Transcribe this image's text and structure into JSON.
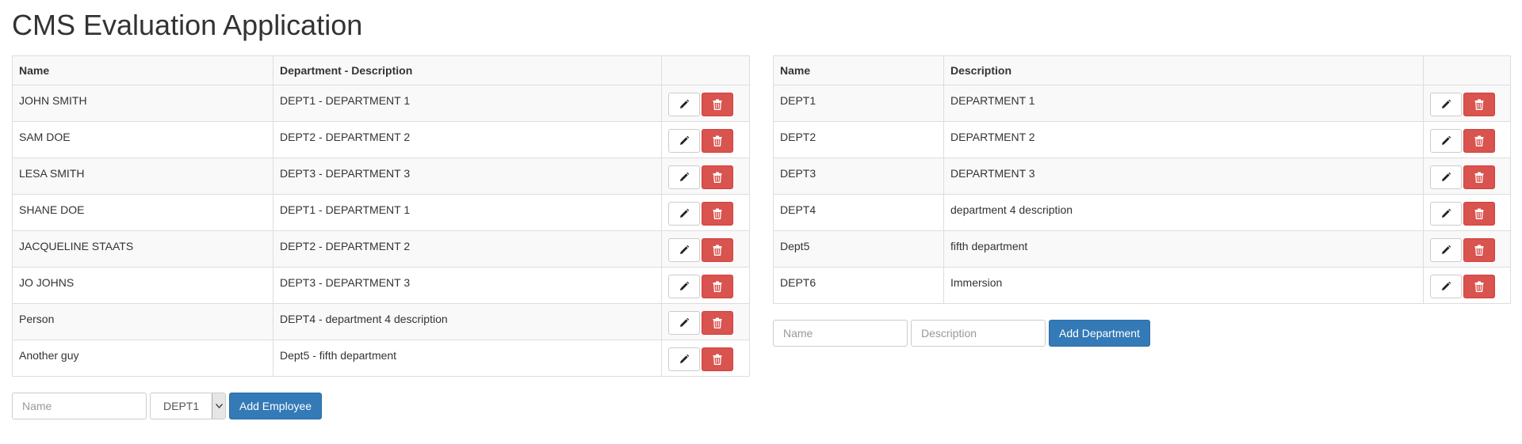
{
  "page": {
    "title": "CMS Evaluation Application"
  },
  "employees": {
    "headers": {
      "name": "Name",
      "dept": "Department - Description"
    },
    "rows": [
      {
        "name": "JOHN SMITH",
        "dept": "DEPT1 - DEPARTMENT 1"
      },
      {
        "name": "SAM DOE",
        "dept": "DEPT2 - DEPARTMENT 2"
      },
      {
        "name": "LESA SMITH",
        "dept": "DEPT3 - DEPARTMENT 3"
      },
      {
        "name": "SHANE DOE",
        "dept": "DEPT1 - DEPARTMENT 1"
      },
      {
        "name": "JACQUELINE STAATS",
        "dept": "DEPT2 - DEPARTMENT 2"
      },
      {
        "name": "JO JOHNS",
        "dept": "DEPT3 - DEPARTMENT 3"
      },
      {
        "name": "Person",
        "dept": "DEPT4 - department 4 description"
      },
      {
        "name": "Another guy",
        "dept": "Dept5 - fifth department"
      }
    ],
    "form": {
      "name_placeholder": "Name",
      "dept_selected": "DEPT1",
      "add_label": "Add Employee"
    }
  },
  "departments": {
    "headers": {
      "name": "Name",
      "description": "Description"
    },
    "rows": [
      {
        "name": "DEPT1",
        "description": "DEPARTMENT 1"
      },
      {
        "name": "DEPT2",
        "description": "DEPARTMENT 2"
      },
      {
        "name": "DEPT3",
        "description": "DEPARTMENT 3"
      },
      {
        "name": "DEPT4",
        "description": "department 4 description"
      },
      {
        "name": "Dept5",
        "description": "fifth department"
      },
      {
        "name": "DEPT6",
        "description": "Immersion"
      }
    ],
    "form": {
      "name_placeholder": "Name",
      "description_placeholder": "Description",
      "add_label": "Add Department"
    }
  },
  "icons": {
    "edit": "pencil-icon",
    "delete": "trash-icon"
  },
  "colors": {
    "primary": "#337ab7",
    "danger": "#d9534f",
    "border": "#dddddd",
    "stripe": "#f9f9f9"
  }
}
